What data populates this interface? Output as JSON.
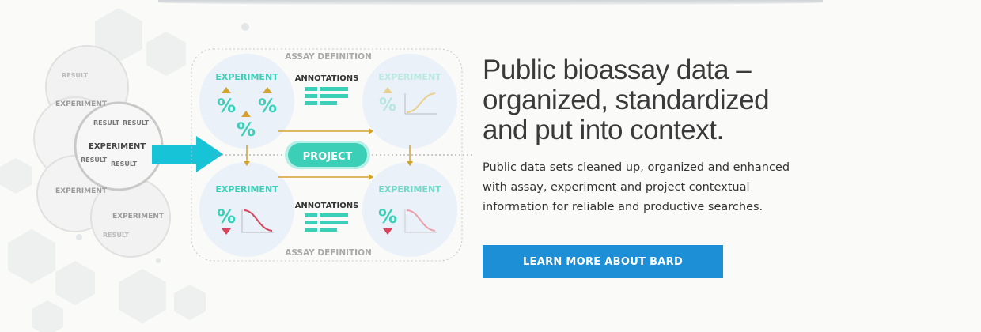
{
  "hero": {
    "headline": [
      "Public bioassay data –",
      "organized, standardized",
      "and put into context."
    ],
    "body": "Public data sets cleaned up, organized and enhanced with assay, experiment and project contextual information for reliable and productive searches.",
    "cta_label": "LEARN MORE ABOUT BARD"
  },
  "diagram": {
    "assay_definition_label": "ASSAY DEFINITION",
    "experiment_label": "EXPERIMENT",
    "annotations_label": "ANNOTATIONS",
    "project_label": "PROJECT",
    "percent_symbol": "%",
    "result_label": "RESULT"
  },
  "colors": {
    "teal": "#3ccfb8",
    "blue_button": "#1c8fd6",
    "arrow_cyan": "#17c3d6",
    "gold": "#d4a22c",
    "red": "#d6455a"
  }
}
